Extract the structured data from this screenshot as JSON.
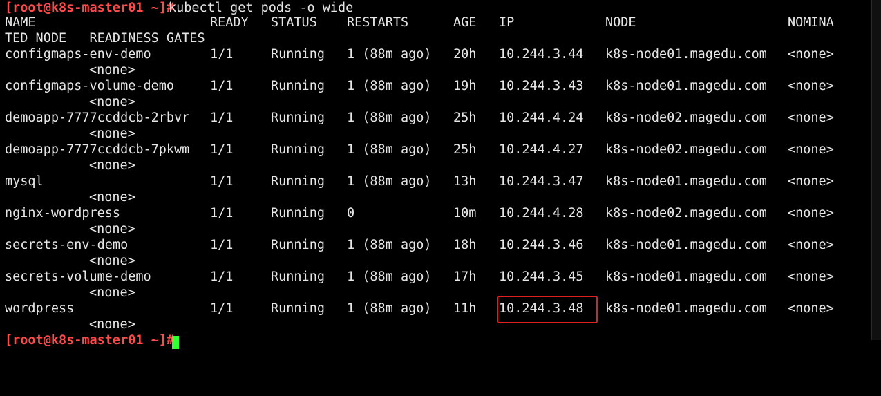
{
  "colors": {
    "background": "#000000",
    "text": "#e6e6e6",
    "prompt": "#ff4a4a",
    "cursor": "#33ff33",
    "highlight": "#e02020"
  },
  "prompt": "[root@k8s-master01 ~]#",
  "command": "kubectl get pods -o wide",
  "header": {
    "name": "NAME",
    "ready": "READY",
    "status": "STATUS",
    "restarts": "RESTARTS",
    "age": "AGE",
    "ip": "IP",
    "node": "NODE",
    "nominated_start": "NOMINA",
    "nominated_end_and_readiness": "TED NODE   READINESS GATES"
  },
  "pods": [
    {
      "name": "configmaps-env-demo",
      "ready": "1/1",
      "status": "Running",
      "restarts": "1 (88m ago)",
      "age": "20h",
      "ip": "10.244.3.44",
      "node": "k8s-node01.magedu.com",
      "nominated": "<none>",
      "readiness": "<none>"
    },
    {
      "name": "configmaps-volume-demo",
      "ready": "1/1",
      "status": "Running",
      "restarts": "1 (88m ago)",
      "age": "19h",
      "ip": "10.244.3.43",
      "node": "k8s-node01.magedu.com",
      "nominated": "<none>",
      "readiness": "<none>"
    },
    {
      "name": "demoapp-7777ccddcb-2rbvr",
      "ready": "1/1",
      "status": "Running",
      "restarts": "1 (88m ago)",
      "age": "25h",
      "ip": "10.244.4.24",
      "node": "k8s-node02.magedu.com",
      "nominated": "<none>",
      "readiness": "<none>"
    },
    {
      "name": "demoapp-7777ccddcb-7pkwm",
      "ready": "1/1",
      "status": "Running",
      "restarts": "1 (88m ago)",
      "age": "25h",
      "ip": "10.244.4.27",
      "node": "k8s-node02.magedu.com",
      "nominated": "<none>",
      "readiness": "<none>"
    },
    {
      "name": "mysql",
      "ready": "1/1",
      "status": "Running",
      "restarts": "1 (88m ago)",
      "age": "13h",
      "ip": "10.244.3.47",
      "node": "k8s-node01.magedu.com",
      "nominated": "<none>",
      "readiness": "<none>"
    },
    {
      "name": "nginx-wordpress",
      "ready": "1/1",
      "status": "Running",
      "restarts": "0",
      "age": "10m",
      "ip": "10.244.4.28",
      "node": "k8s-node02.magedu.com",
      "nominated": "<none>",
      "readiness": "<none>"
    },
    {
      "name": "secrets-env-demo",
      "ready": "1/1",
      "status": "Running",
      "restarts": "1 (88m ago)",
      "age": "18h",
      "ip": "10.244.3.46",
      "node": "k8s-node01.magedu.com",
      "nominated": "<none>",
      "readiness": "<none>"
    },
    {
      "name": "secrets-volume-demo",
      "ready": "1/1",
      "status": "Running",
      "restarts": "1 (88m ago)",
      "age": "17h",
      "ip": "10.244.3.45",
      "node": "k8s-node01.magedu.com",
      "nominated": "<none>",
      "readiness": "<none>"
    },
    {
      "name": "wordpress",
      "ready": "1/1",
      "status": "Running",
      "restarts": "1 (88m ago)",
      "age": "11h",
      "ip": "10.244.3.48",
      "node": "k8s-node01.magedu.com",
      "nominated": "<none>",
      "readiness": "<none>"
    }
  ],
  "final_prompt": "[root@k8s-master01 ~]#",
  "highlighted_ip": "10.244.3.48"
}
